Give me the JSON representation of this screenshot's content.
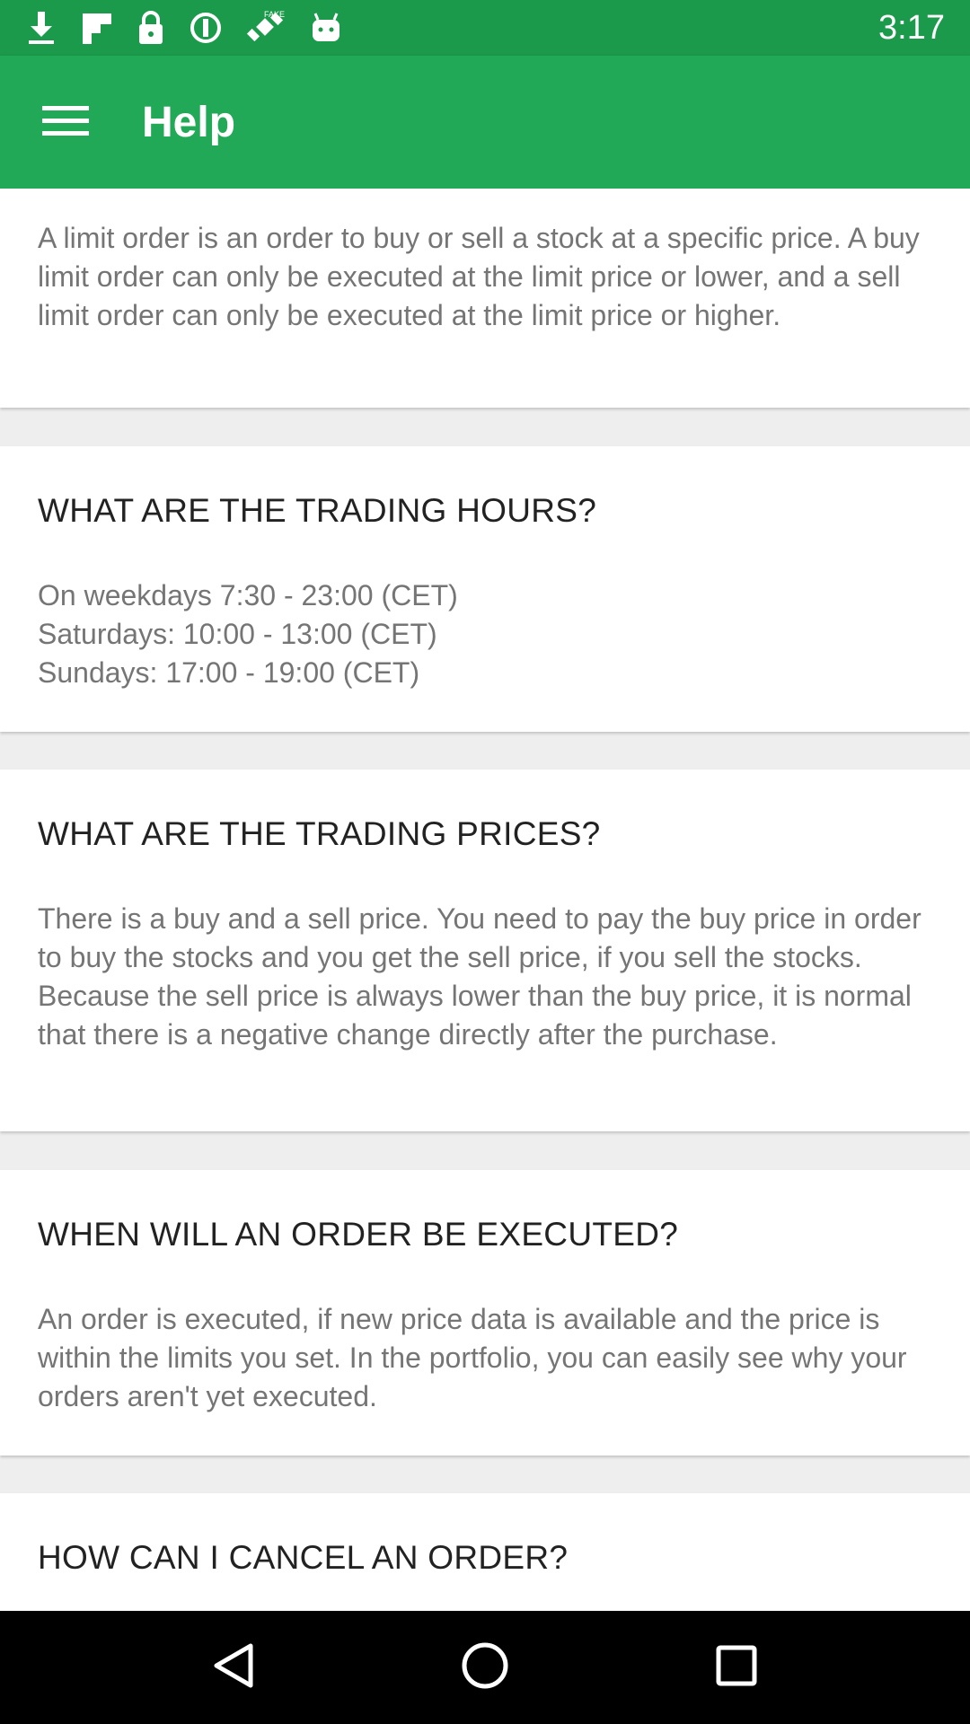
{
  "status_bar": {
    "time": "3:17",
    "icons": [
      "download-icon",
      "flipboard-icon",
      "lock-icon",
      "data-saver-icon",
      "fake-gps-icon",
      "android-icon"
    ]
  },
  "app_bar": {
    "title": "Help",
    "menu_icon": "hamburger-menu-icon"
  },
  "faq": [
    {
      "question": "",
      "answer": "A limit order is an order to buy or sell a stock at a specific price. A buy limit order can only be executed at the limit price or lower, and a sell limit order can only be executed at the limit price or higher."
    },
    {
      "question": "WHAT ARE THE TRADING HOURS?",
      "answer": "On weekdays 7:30 - 23:00 (CET)\nSaturdays: 10:00 - 13:00 (CET)\nSundays: 17:00 - 19:00 (CET)"
    },
    {
      "question": "WHAT ARE THE TRADING PRICES?",
      "answer": "There is a buy and a sell price. You need to pay the buy price in order to buy the stocks and you get the sell price, if you sell the stocks. Because the sell price is always lower than the buy price, it is normal that there is a negative change directly after the purchase."
    },
    {
      "question": "WHEN WILL AN ORDER BE EXECUTED?",
      "answer": "An order is executed, if new price data is available and the price is within the limits you set. In the portfolio, you can easily see why your orders aren't yet executed."
    },
    {
      "question": "HOW CAN I CANCEL AN ORDER?",
      "answer": ""
    }
  ],
  "nav_bar": {
    "back_icon": "back-triangle-icon",
    "home_icon": "home-circle-icon",
    "recents_icon": "recents-square-icon"
  },
  "colors": {
    "status_bar": "#1a9a4a",
    "app_bar": "#22a957",
    "background": "#eeeeee"
  }
}
